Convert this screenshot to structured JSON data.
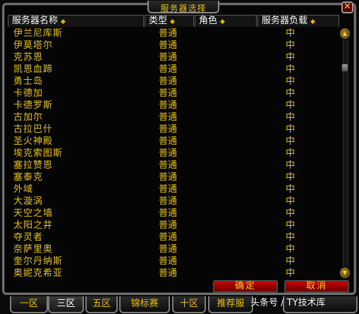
{
  "window": {
    "title": "服务器选择"
  },
  "header": {
    "name": "服务器名称",
    "type": "类型",
    "role": "角色",
    "load": "服务器负载"
  },
  "icons": {
    "sort": "sort-arrow-icon",
    "close": "close-icon",
    "scroll_up": "scroll-up-icon",
    "scroll_down": "scroll-down-icon"
  },
  "servers": [
    {
      "name": "伊兰尼库斯",
      "type": "普通",
      "load": "中"
    },
    {
      "name": "伊莫塔尔",
      "type": "普通",
      "load": "中"
    },
    {
      "name": "克苏恩",
      "type": "普通",
      "load": "中"
    },
    {
      "name": "凯恩血蹄",
      "type": "普通",
      "load": "中"
    },
    {
      "name": "勇士岛",
      "type": "普通",
      "load": "中"
    },
    {
      "name": "卡德加",
      "type": "普通",
      "load": "中"
    },
    {
      "name": "卡德罗斯",
      "type": "普通",
      "load": "中"
    },
    {
      "name": "古加尔",
      "type": "普通",
      "load": "中"
    },
    {
      "name": "古拉巴什",
      "type": "普通",
      "load": "中"
    },
    {
      "name": "圣火神殿",
      "type": "普通",
      "load": "中"
    },
    {
      "name": "埃克索图斯",
      "type": "普通",
      "load": "中"
    },
    {
      "name": "塞拉赞恩",
      "type": "普通",
      "load": "中"
    },
    {
      "name": "塞泰克",
      "type": "普通",
      "load": "中"
    },
    {
      "name": "外域",
      "type": "普通",
      "load": "中"
    },
    {
      "name": "大漩涡",
      "type": "普通",
      "load": "中"
    },
    {
      "name": "天空之墙",
      "type": "普通",
      "load": "中"
    },
    {
      "name": "太阳之井",
      "type": "普通",
      "load": "中"
    },
    {
      "name": "夺灵者",
      "type": "普通",
      "load": "中"
    },
    {
      "name": "奈萨里奥",
      "type": "普通",
      "load": "中"
    },
    {
      "name": "奎尔丹纳斯",
      "type": "普通",
      "load": "中"
    },
    {
      "name": "奥妮克希亚",
      "type": "普通",
      "load": "中"
    }
  ],
  "buttons": {
    "ok": "确定",
    "cancel": "取消"
  },
  "tabs": [
    {
      "label": "一区"
    },
    {
      "label": "三区"
    },
    {
      "label": "五区"
    },
    {
      "label": "锦标赛"
    },
    {
      "label": "十区"
    },
    {
      "label": "推荐服"
    },
    {
      "label": ""
    }
  ],
  "watermark": {
    "text": "头条号 / TY技术库"
  },
  "colors": {
    "gold": "#e8c100",
    "button_red": "#c30000",
    "frame_gray": "#6e6e6e"
  }
}
